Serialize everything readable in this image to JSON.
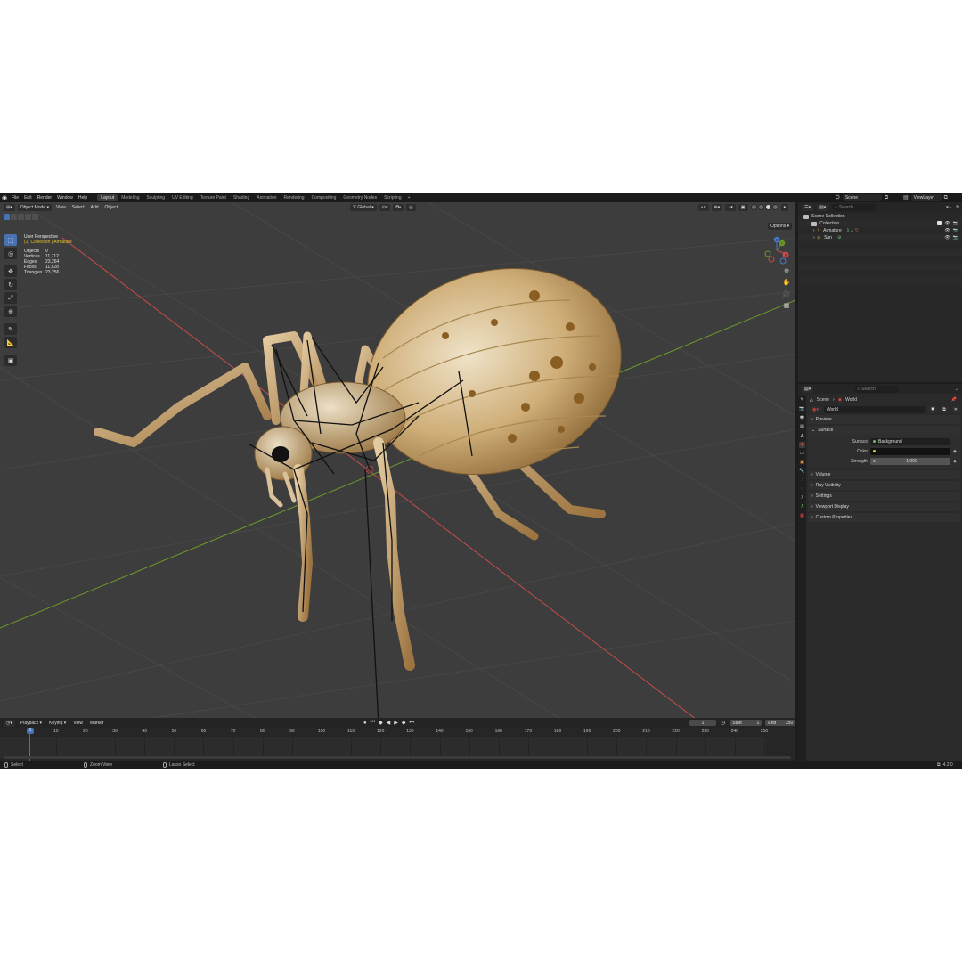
{
  "topbar": {
    "menus": [
      "File",
      "Edit",
      "Render",
      "Window",
      "Help"
    ],
    "workspaces": [
      {
        "label": "Layout",
        "active": true
      },
      {
        "label": "Modeling",
        "active": false
      },
      {
        "label": "Sculpting",
        "active": false
      },
      {
        "label": "UV Editing",
        "active": false
      },
      {
        "label": "Texture Paint",
        "active": false
      },
      {
        "label": "Shading",
        "active": false
      },
      {
        "label": "Animation",
        "active": false
      },
      {
        "label": "Rendering",
        "active": false
      },
      {
        "label": "Compositing",
        "active": false
      },
      {
        "label": "Geometry Nodes",
        "active": false
      },
      {
        "label": "Scripting",
        "active": false
      }
    ],
    "add_workspace": "+",
    "scene": "Scene",
    "view_layer": "ViewLayer"
  },
  "viewport": {
    "mode": "Object Mode",
    "menus": [
      "View",
      "Select",
      "Add",
      "Object"
    ],
    "orientation": "Global",
    "options": "Options",
    "perspective": "User Perspective",
    "collection_path": "(1) Collection | Armature",
    "stats": [
      {
        "label": "Objects",
        "value": "0"
      },
      {
        "label": "Vertices",
        "value": "11,712"
      },
      {
        "label": "Edges",
        "value": "23,264"
      },
      {
        "label": "Faces",
        "value": "11,628"
      },
      {
        "label": "Triangles",
        "value": "23,256"
      }
    ],
    "gizmo_axes": [
      "X",
      "Y",
      "Z"
    ]
  },
  "timeline": {
    "menus": [
      "Playback",
      "Keying",
      "View",
      "Marker"
    ],
    "current_frame": "1",
    "start_label": "Start",
    "start": "1",
    "end_label": "End",
    "end": "250",
    "ticks": [
      "1",
      "10",
      "20",
      "30",
      "40",
      "50",
      "60",
      "70",
      "80",
      "90",
      "100",
      "110",
      "120",
      "130",
      "140",
      "150",
      "160",
      "170",
      "180",
      "190",
      "200",
      "210",
      "220",
      "230",
      "240",
      "250"
    ]
  },
  "statusbar": {
    "items": [
      "Select",
      "Zoom View",
      "Lasso Select"
    ],
    "version": "4.2.0"
  },
  "outliner": {
    "search_placeholder": "Search",
    "rows": [
      {
        "label": "Scene Collection"
      },
      {
        "label": "Collection"
      },
      {
        "label": "Armature"
      },
      {
        "label": "Sun"
      }
    ]
  },
  "properties": {
    "search_placeholder": "Search",
    "breadcrumb": [
      "Scene",
      "World"
    ],
    "world_name": "World",
    "panels": {
      "preview": "Preview",
      "surface": "Surface",
      "volume": "Volume",
      "ray_visibility": "Ray Visibility",
      "settings": "Settings",
      "viewport_display": "Viewport Display",
      "custom_properties": "Custom Properties"
    },
    "surface_label": "Surface",
    "surface_value": "Background",
    "color_label": "Color",
    "color_value": "#121212",
    "strength_label": "Strength",
    "strength_value": "1.000"
  },
  "colors": {
    "accent": "#4772b3",
    "collection_text": "#e5c62a",
    "x_axis": "#c74b4b",
    "y_axis": "#6d9a2a"
  }
}
